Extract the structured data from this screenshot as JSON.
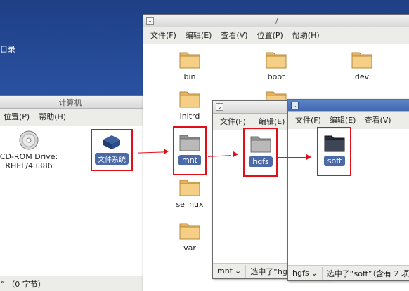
{
  "desktop": {
    "label": "目录"
  },
  "computer_window": {
    "title": "计算机",
    "menu": [
      "位置(P)",
      "帮助(H)"
    ],
    "items": [
      {
        "label": "CD-ROM Drive:\nRHEL/4 i386",
        "icon": "cdrom-icon"
      },
      {
        "label": "文件系统",
        "icon": "harddisk-icon",
        "selected": true
      }
    ],
    "status": "” （0 字节）"
  },
  "root_window": {
    "title": "/",
    "menu": [
      "文件(F)",
      "编辑(E)",
      "查看(V)",
      "位置(P)",
      "帮助(H)"
    ],
    "folders": [
      "bin",
      "boot",
      "dev",
      "initrd",
      "mnt",
      "selinux",
      "var"
    ],
    "selected": "mnt"
  },
  "mnt_window": {
    "menu": [
      "文件(F)",
      "编辑(E)"
    ],
    "folder": "hgfs",
    "path_label": "mnt",
    "status": "选中了“hgf"
  },
  "hgfs_window": {
    "menu": [
      "文件(F)",
      "编辑(E)",
      "查看(V)"
    ],
    "folder": "soft",
    "path_label": "hgfs",
    "status": "选中了“soft”（含有 2 项"
  },
  "colors": {
    "highlight": "#e0101a",
    "selection": "#4a6aa8",
    "folder": "#f2c777"
  }
}
